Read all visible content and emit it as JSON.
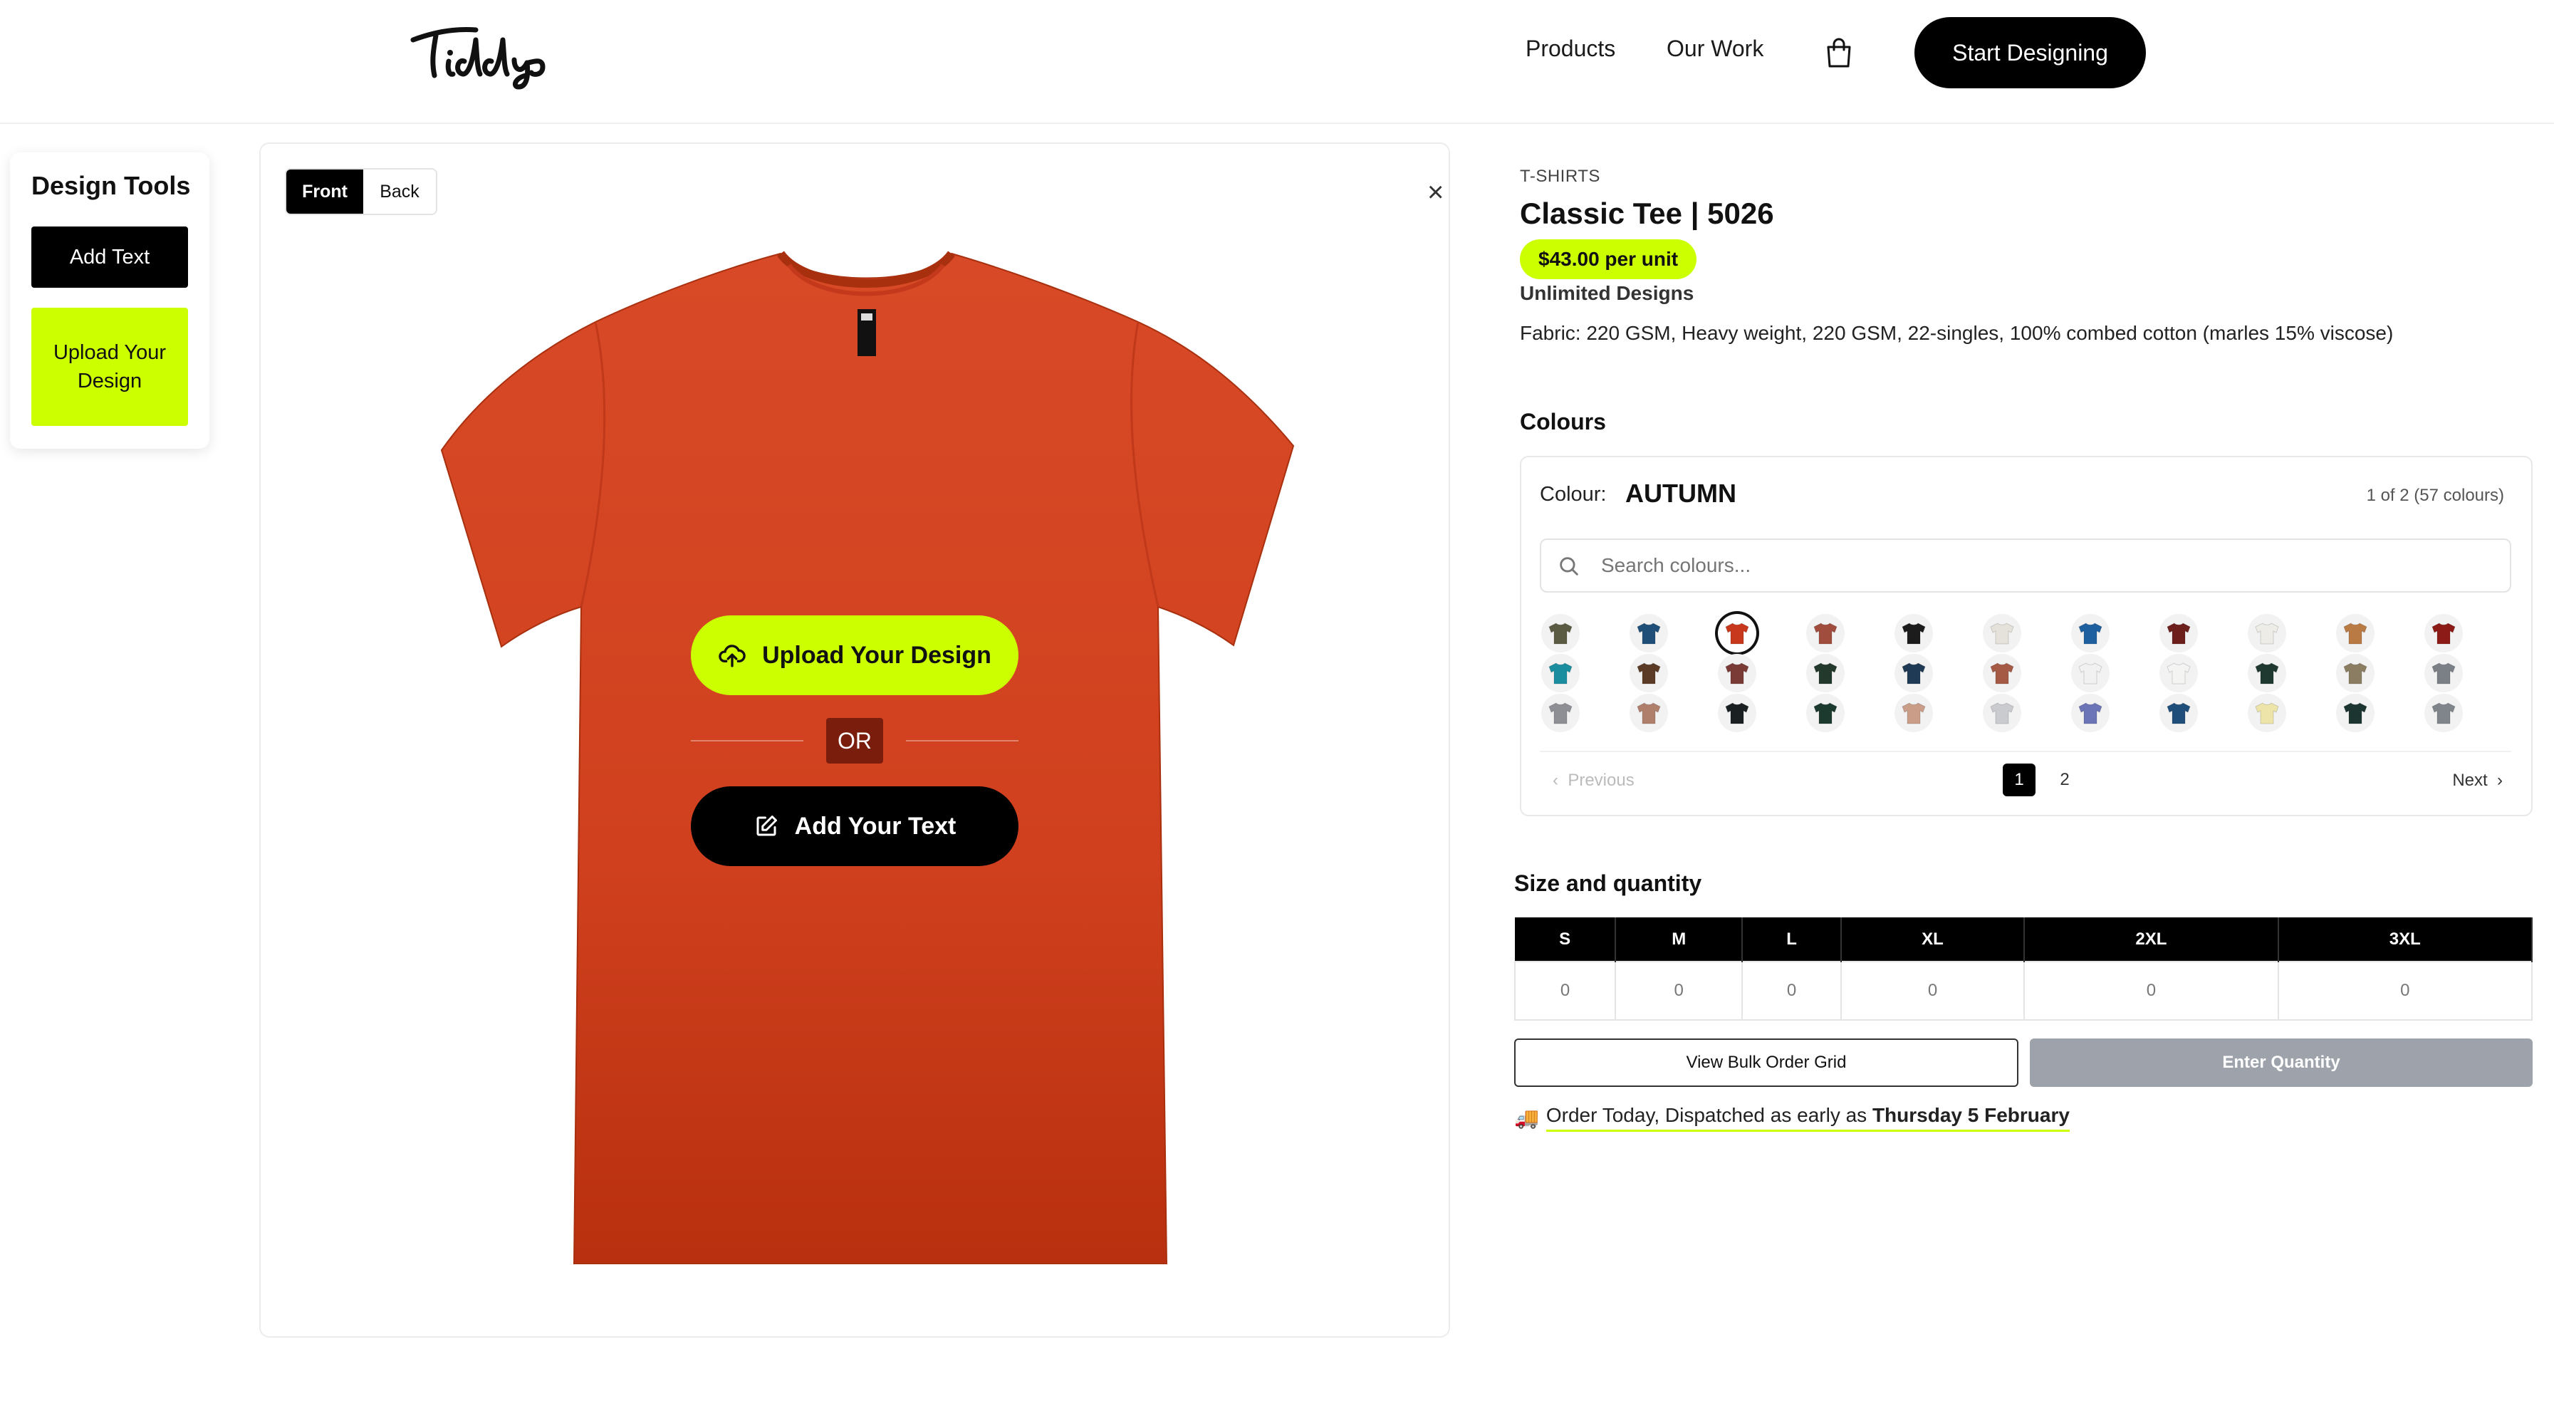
{
  "header": {
    "logo_text": "Tiddys",
    "nav": [
      "Products",
      "Our Work"
    ],
    "cta": "Start Designing"
  },
  "tools": {
    "title": "Design Tools",
    "add_text": "Add Text",
    "upload": "Upload Your Design"
  },
  "canvas": {
    "sides": [
      "Front",
      "Back"
    ],
    "active_side": "Front",
    "close": "×",
    "upload_cta": "Upload Your Design",
    "or": "OR",
    "text_cta": "Add Your Text",
    "shirt_color": "#D2401F"
  },
  "product": {
    "category": "T-SHIRTS",
    "title": "Classic Tee | 5026",
    "price": "$43.00 per unit",
    "designs": "Unlimited Designs",
    "fabric": "Fabric: 220 GSM, Heavy weight, 220 GSM, 22-singles, 100% combed cotton (marles 15% viscose)"
  },
  "colours": {
    "heading": "Colours",
    "label": "Colour:",
    "selected": "AUTUMN",
    "count": "1 of 2  (57 colours)",
    "search_placeholder": "Search colours...",
    "swatches": [
      [
        "#5b5b43",
        "#1f4f79",
        "#c8381c",
        "#a14d3e",
        "#1c1c1c",
        "#e5e2dc",
        "#1e5fa0",
        "#6d1f1c",
        "#eeece6",
        "#b97a44",
        "#8c1a16"
      ],
      [
        "#1a8e9e",
        "#5b3a26",
        "#7a3b36",
        "#22392c",
        "#1f3a55",
        "#a55a45",
        "#f1f1f1",
        "#f4f4f2",
        "#1f3830",
        "#8b7d62",
        "#7b7f86"
      ],
      [
        "#8d8f94",
        "#b07f6b",
        "#1a1f22",
        "#1c3a2e",
        "#c99d87",
        "#c9cbcf",
        "#6a74b6",
        "#1f4e7a",
        "#ece4a8",
        "#1c3530",
        "#80858b"
      ]
    ],
    "selected_index": [
      0,
      2
    ],
    "prev": "Previous",
    "pages": [
      "1",
      "2"
    ],
    "next": "Next"
  },
  "sizes": {
    "heading": "Size and quantity",
    "columns": [
      "S",
      "M",
      "L",
      "XL",
      "2XL",
      "3XL"
    ],
    "values": [
      "0",
      "0",
      "0",
      "0",
      "0",
      "0"
    ],
    "bulk_label": "View Bulk Order Grid",
    "enter_label": "Enter Quantity"
  },
  "dispatch": {
    "emoji": "🚚",
    "text": "Order Today, Dispatched as early as",
    "date": "Thursday 5 February"
  },
  "colors": {
    "accent": "#CCFF00",
    "dark": "#000000"
  }
}
